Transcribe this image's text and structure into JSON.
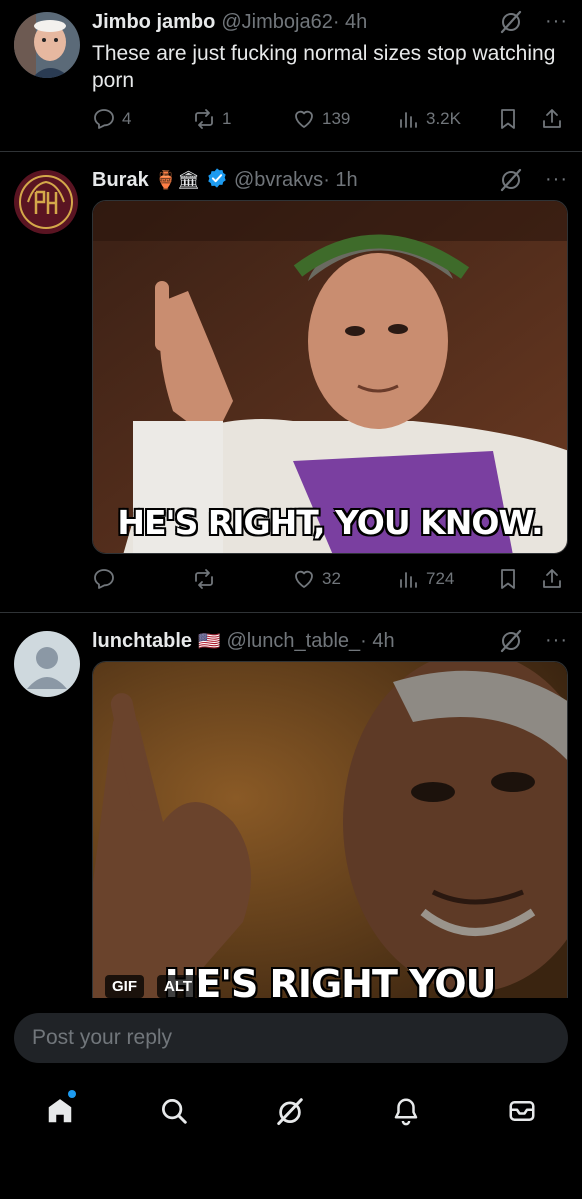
{
  "posts": [
    {
      "author": "Jimbo jambo",
      "handle": "@Jimboja62",
      "time": "· 4h",
      "text": "These are just fucking normal sizes stop watching porn",
      "replies": "4",
      "reposts": "1",
      "likes": "139",
      "views": "3.2K"
    },
    {
      "author": "Burak",
      "badges": "🏺🏛",
      "handle": "@bvrakvs",
      "time": "· 1h",
      "media_caption": "HE'S RIGHT, YOU KNOW.",
      "replies": "",
      "reposts": "",
      "likes": "32",
      "views": "724"
    },
    {
      "author": "lunchtable",
      "badges": "🇺🇸",
      "handle": "@lunch_table_",
      "time": "· 4h",
      "media_caption": "HE'S RIGHT YOU KNOW",
      "gif_label": "GIF",
      "alt_label": "ALT"
    }
  ],
  "reply": {
    "placeholder": "Post your reply"
  },
  "colors": {
    "background": "#000000",
    "text": "#e7e9ea",
    "muted": "#71767b",
    "accent": "#1d9bf0",
    "verified": "#1d9bf0"
  },
  "icons": [
    "reply-icon",
    "repost-icon",
    "like-icon",
    "views-icon",
    "bookmark-icon",
    "share-icon",
    "grok-icon",
    "more-icon",
    "home-icon",
    "search-icon",
    "grok-nav-icon",
    "notifications-icon",
    "messages-icon",
    "verified-icon"
  ]
}
